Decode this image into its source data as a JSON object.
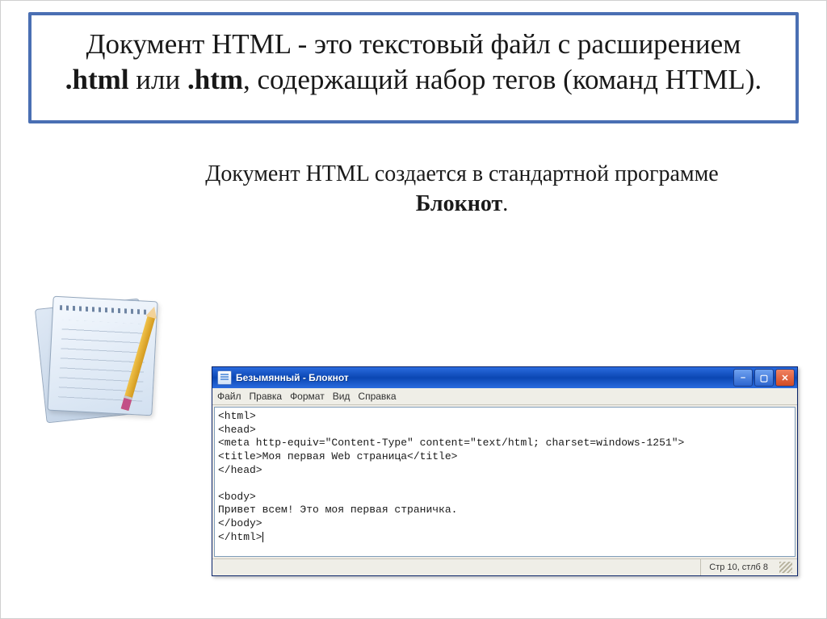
{
  "title": {
    "part1": "Документ HTML - это текстовый файл с расширением ",
    "bold1": ".html",
    "part2": " или ",
    "bold2": ".htm",
    "part3": ", содержащий набор тегов (команд HTML)."
  },
  "subtitle": {
    "part1": "Документ HTML создается в стандартной программе ",
    "bold": "Блокнот",
    "part2": "."
  },
  "notepad": {
    "title": "Безымянный - Блокнот",
    "menu": [
      "Файл",
      "Правка",
      "Формат",
      "Вид",
      "Справка"
    ],
    "content_lines": [
      "<html>",
      "<head>",
      "<meta http-equiv=\"Content-Type\" content=\"text/html; charset=windows-1251\">",
      "<title>Моя первая Web страница</title>",
      "</head>",
      "",
      "<body>",
      "Привет всем! Это моя первая страничка.",
      "</body>",
      "</html>"
    ],
    "status": "Стр 10, стлб 8"
  },
  "winbuttons": {
    "min": "–",
    "max": "▢",
    "close": "✕"
  }
}
